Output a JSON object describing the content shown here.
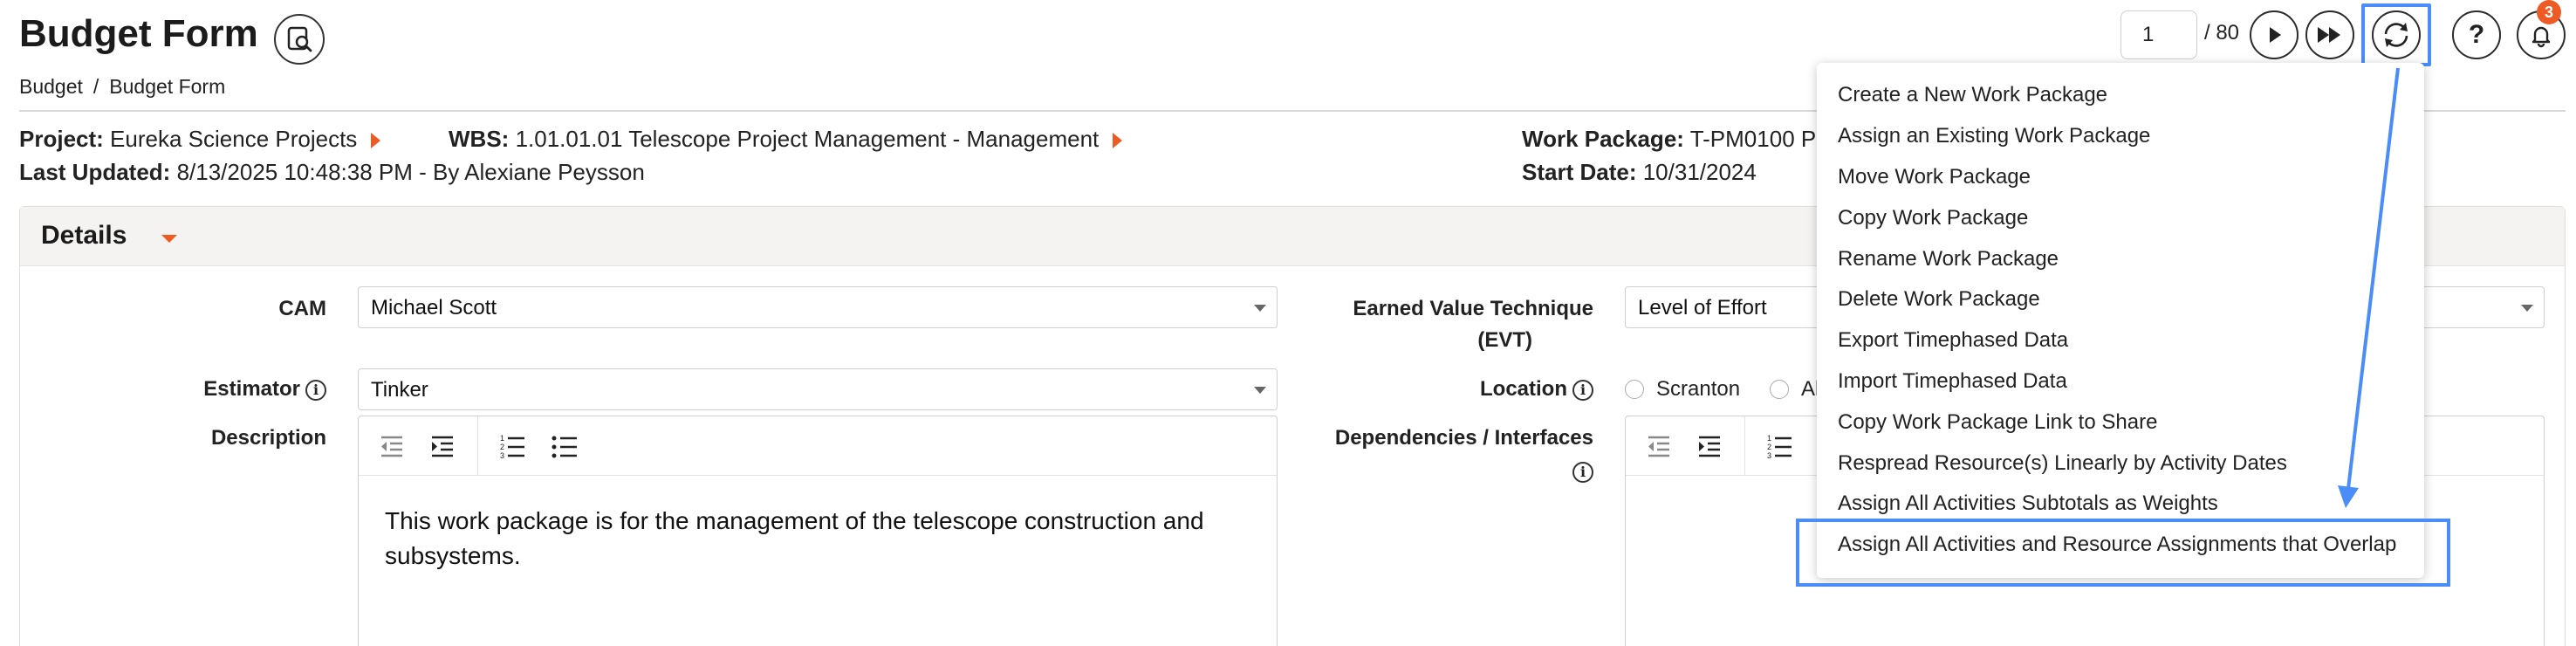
{
  "header": {
    "title": "Budget Form",
    "preview_icon": "search-document-icon",
    "breadcrumb": [
      "Budget",
      "/",
      "Budget Form"
    ]
  },
  "pager": {
    "current": "1",
    "total": "/ 80",
    "next_icon": "play-icon",
    "last_icon": "fast-forward-icon",
    "actions_icon": "refresh-icon",
    "help_icon": "question-icon",
    "notifications_icon": "bell-icon",
    "notification_count": "3",
    "help_label": "?"
  },
  "info": {
    "project_label": "Project:",
    "project_value": "Eureka Science Projects",
    "wbs_label": "WBS:",
    "wbs_value": "1.01.01.01 Telescope Project Management - Management",
    "work_package_label": "Work Package:",
    "work_package_value": "T-PM0100 Pro",
    "last_updated_label": "Last Updated:",
    "last_updated_value": "8/13/2025 10:48:38 PM - By Alexiane Peysson",
    "start_date_label": "Start Date:",
    "start_date_value": "10/31/2024"
  },
  "details": {
    "title": "Details",
    "cam_label": "CAM",
    "cam_value": "Michael Scott",
    "estimator_label": "Estimator",
    "estimator_value": "Tinker",
    "description_label": "Description",
    "description_text": "This work package is for the management of the telescope construction and subsystems.",
    "evt_label_1": "Earned Value Technique",
    "evt_label_2": "(EVT)",
    "evt_value": "Level of Effort",
    "location_label": "Location",
    "location_options": [
      "Scranton",
      "Al"
    ],
    "dependencies_label": "Dependencies / Interfaces",
    "info_glyph": "i"
  },
  "menu": {
    "items": [
      "Create a New Work Package",
      "Assign an Existing Work Package",
      "Move Work Package",
      "Copy Work Package",
      "Rename Work Package",
      "Delete Work Package",
      "Export Timephased Data",
      "Import Timephased Data",
      "Copy Work Package Link to Share",
      "Respread Resource(s) Linearly by Activity Dates",
      "Assign All Activities Subtotals as Weights",
      "Assign All Activities and Resource Assignments that Overlap"
    ]
  },
  "colors": {
    "accent": "#ee5a24",
    "highlight": "#4b8df8",
    "panel_header": "#f4f3f1"
  }
}
